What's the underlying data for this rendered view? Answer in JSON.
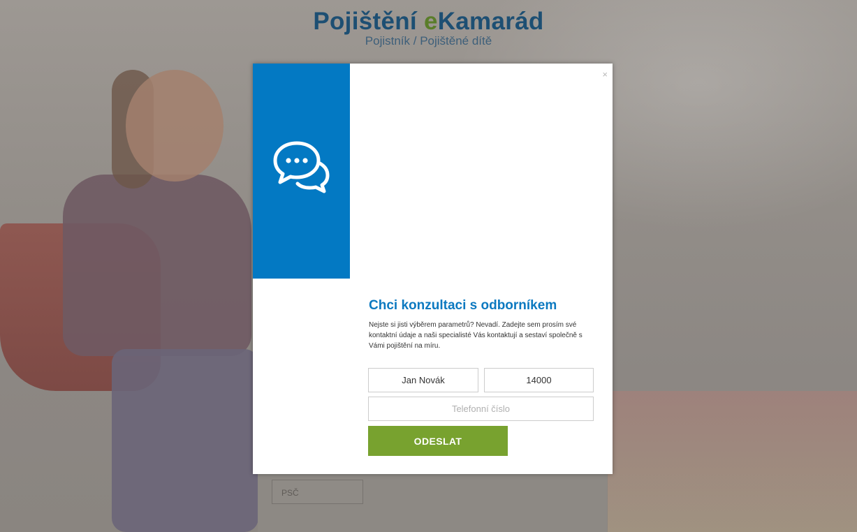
{
  "header": {
    "brand_prefix": "Pojištění ",
    "brand_e": "e",
    "brand_suffix": "Kamarád",
    "subtitle": "Pojistník / Pojištěné dítě"
  },
  "background_form": {
    "psc_placeholder": "PSČ"
  },
  "modal": {
    "close_label": "×",
    "chat_icon": "chat-bubbles-icon",
    "title": "Chci konzultaci s odborníkem",
    "description": "Nejste si jisti výběrem parametrů? Nevadí. Zadejte sem prosím své kontaktní údaje a naši specialisté Vás kontaktují a sestaví společně s Vámi pojištění na míru.",
    "name_value": "Jan Novák",
    "psc_value": "14000",
    "phone_placeholder": "Telefonní číslo",
    "submit_label": "ODESLAT"
  },
  "colors": {
    "accent_blue": "#0379c3",
    "button_green": "#78a22f",
    "brand_navy": "#1d4f73"
  }
}
